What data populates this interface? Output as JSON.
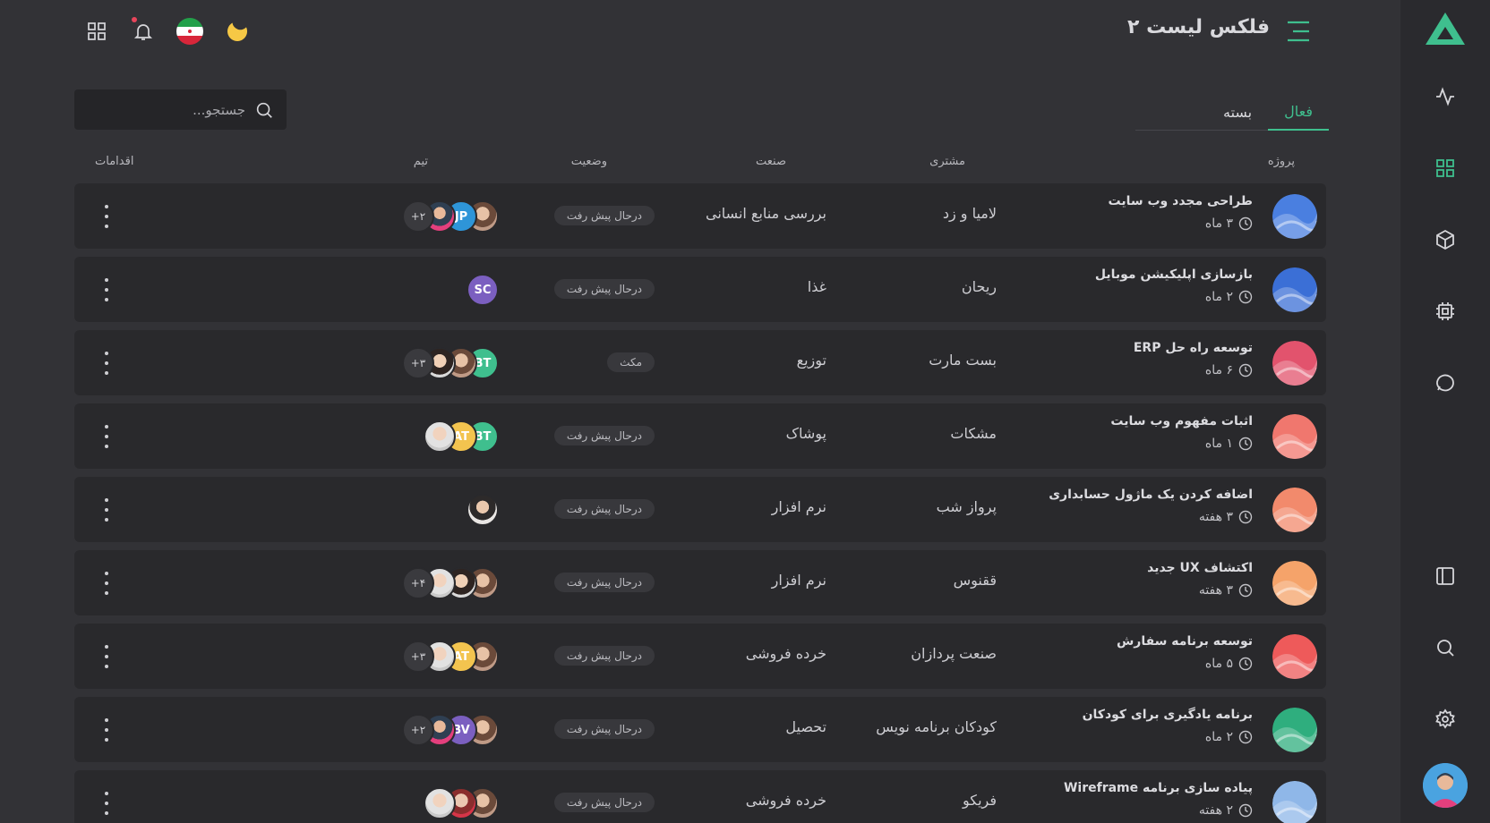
{
  "header": {
    "title": "فلکس لیست ۲",
    "menu_icon": "menu-icon",
    "moon_icon": "moon-icon",
    "flag_icon": "iran-flag-icon",
    "bell_icon": "bell-icon",
    "apps_icon": "apps-grid-icon"
  },
  "tabs": [
    {
      "label": "فعال",
      "active": true
    },
    {
      "label": "بسته",
      "active": false
    }
  ],
  "search": {
    "placeholder": "جستجو..."
  },
  "columns": {
    "project": "پروژه",
    "client": "مشتری",
    "industry": "صنعت",
    "status": "وضعیت",
    "team": "تیم",
    "actions": "اقدامات"
  },
  "rows": [
    {
      "name": "طراحی مجدد وب سایت",
      "duration": "۳ ماه",
      "client": "لامیا و زد",
      "industry": "بررسی منابع انسانی",
      "status": "درحال پیش رفت",
      "team": [
        {
          "type": "photo"
        },
        {
          "type": "initials",
          "text": "JP",
          "color": "#2e95d8"
        },
        {
          "type": "pink"
        },
        {
          "type": "more",
          "text": "+۲"
        }
      ]
    },
    {
      "name": "بازسازی اپلیکیشن موبایل",
      "duration": "۲ ماه",
      "client": "ریحان",
      "industry": "غذا",
      "status": "درحال پیش رفت",
      "team": [
        {
          "type": "initials",
          "text": "SC",
          "color": "#7b5fc0"
        }
      ]
    },
    {
      "name": "توسعه راه حل ERP",
      "duration": "۶ ماه",
      "client": "بست مارت",
      "industry": "توزیع",
      "status": "مکث",
      "team": [
        {
          "type": "initials",
          "text": "BT",
          "color": "#3fbf8e"
        },
        {
          "type": "photo"
        },
        {
          "type": "photo2"
        },
        {
          "type": "more",
          "text": "+۳"
        }
      ]
    },
    {
      "name": "اثبات مفهوم وب سایت",
      "duration": "۱ ماه",
      "client": "مشکات",
      "industry": "پوشاک",
      "status": "درحال پیش رفت",
      "team": [
        {
          "type": "initials",
          "text": "BT",
          "color": "#3fbf8e"
        },
        {
          "type": "initials",
          "text": "AT",
          "color": "#f3c44f"
        },
        {
          "type": "photo4"
        }
      ]
    },
    {
      "name": "اضافه کردن یک ماژول حسابداری",
      "duration": "۳ هفته",
      "client": "پرواز شب",
      "industry": "نرم افزار",
      "status": "درحال پیش رفت",
      "team": [
        {
          "type": "photo3"
        }
      ]
    },
    {
      "name": "اکتشاف UX جدید",
      "duration": "۳ هفته",
      "client": "ققنوس",
      "industry": "نرم افزار",
      "status": "درحال پیش رفت",
      "team": [
        {
          "type": "photo"
        },
        {
          "type": "photo2"
        },
        {
          "type": "photo4"
        },
        {
          "type": "more",
          "text": "+۴"
        }
      ]
    },
    {
      "name": "توسعه برنامه سفارش",
      "duration": "۵ ماه",
      "client": "صنعت پردازان",
      "industry": "خرده فروشی",
      "status": "درحال پیش رفت",
      "team": [
        {
          "type": "photo"
        },
        {
          "type": "initials",
          "text": "AT",
          "color": "#f3c44f"
        },
        {
          "type": "photo4"
        },
        {
          "type": "more",
          "text": "+۳"
        }
      ]
    },
    {
      "name": "برنامه یادگیری برای کودکان",
      "duration": "۲ ماه",
      "client": "کودکان برنامه نویس",
      "industry": "تحصیل",
      "status": "درحال پیش رفت",
      "team": [
        {
          "type": "photo"
        },
        {
          "type": "initials",
          "text": "BV",
          "color": "#7b5fc0"
        },
        {
          "type": "pink"
        },
        {
          "type": "more",
          "text": "+۲"
        }
      ]
    },
    {
      "name": "پیاده سازی برنامه Wireframe",
      "duration": "۲ هفته",
      "client": "فریکو",
      "industry": "خرده فروشی",
      "status": "درحال پیش رفت",
      "team": [
        {
          "type": "photo"
        },
        {
          "type": "photo5"
        },
        {
          "type": "photo4"
        }
      ]
    }
  ],
  "project_icons": [
    "#4a7fe0",
    "#3b6fd6",
    "#e2536d",
    "#f0776e",
    "#f28a6c",
    "#f5a36a",
    "#ee5a5a",
    "#2fae7e",
    "#8fb7e8"
  ],
  "sidebar": {
    "logo_icon": "logo-icon",
    "items": [
      "activity-icon",
      "grid-icon",
      "box-icon",
      "cpu-icon",
      "chat-icon",
      "layout-icon",
      "search-icon",
      "settings-icon"
    ]
  },
  "colors": {
    "accent": "#3fbf8e",
    "background": "#323236",
    "row": "#29292c",
    "sidebar": "#2a2a2e"
  }
}
